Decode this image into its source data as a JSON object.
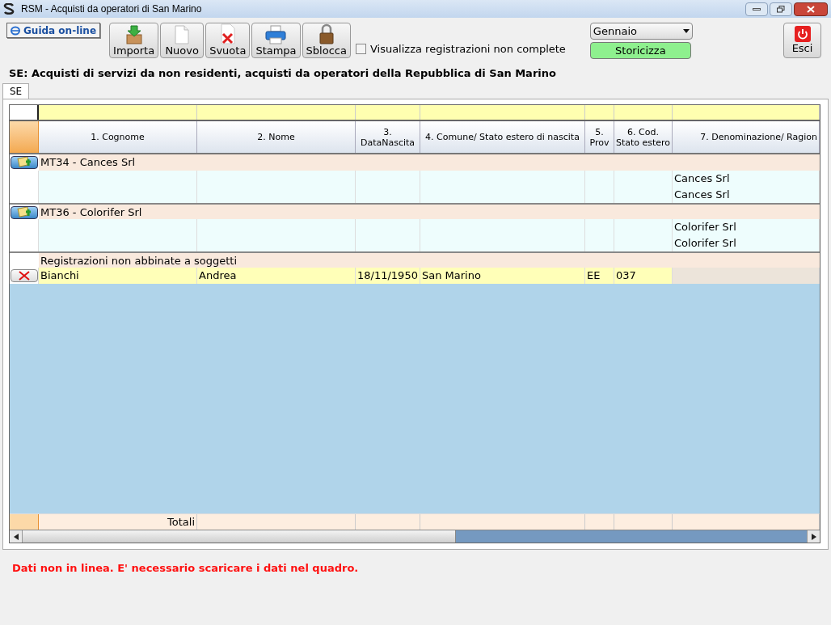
{
  "window": {
    "title": "RSM - Acquisti da operatori di San Marino"
  },
  "help_button": "Guida on-line",
  "toolbar": [
    {
      "kind": "import",
      "label": "Importa"
    },
    {
      "kind": "new",
      "label": "Nuovo"
    },
    {
      "kind": "clear",
      "label": "Svuota"
    },
    {
      "kind": "print",
      "label": "Stampa"
    },
    {
      "kind": "unlock",
      "label": "Sblocca"
    }
  ],
  "incomplete_checkbox": {
    "label": "Visualizza registrazioni non complete",
    "checked": false
  },
  "month_select": {
    "value": "Gennaio"
  },
  "archive_button": "Storicizza",
  "exit_button": "Esci",
  "heading": "SE: Acquisti di servizi da non residenti, acquisti da operatori della Repubblica di San Marino",
  "tabs": [
    {
      "label": "SE",
      "selected": true
    }
  ],
  "table": {
    "columns": [
      "1. Cognome",
      "2. Nome",
      "3. DataNascita",
      "4. Comune/ Stato estero di nascita",
      "5. Prov",
      "6. Cod. Stato estero",
      "7. Denominazione/ Ragion"
    ],
    "rows": [
      {
        "kind": "group",
        "label": "MT34 - Cances Srl"
      },
      {
        "kind": "detail",
        "denominazione": "Cances Srl"
      },
      {
        "kind": "detail",
        "denominazione": "Cances Srl"
      },
      {
        "kind": "group",
        "label": "MT36 - Colorifer Srl"
      },
      {
        "kind": "detail",
        "denominazione": "Colorifer Srl"
      },
      {
        "kind": "detail",
        "denominazione": "Colorifer Srl"
      },
      {
        "kind": "section",
        "label": "Registrazioni non abbinate a soggetti"
      },
      {
        "kind": "record",
        "cognome": "Bianchi",
        "nome": "Andrea",
        "data_nascita": "18/11/1950",
        "comune": "San Marino",
        "prov": "EE",
        "cod_stato": "037"
      }
    ],
    "totals_label": "Totali"
  },
  "message": "Dati non in linea. E' necessario scaricare i dati nel quadro."
}
